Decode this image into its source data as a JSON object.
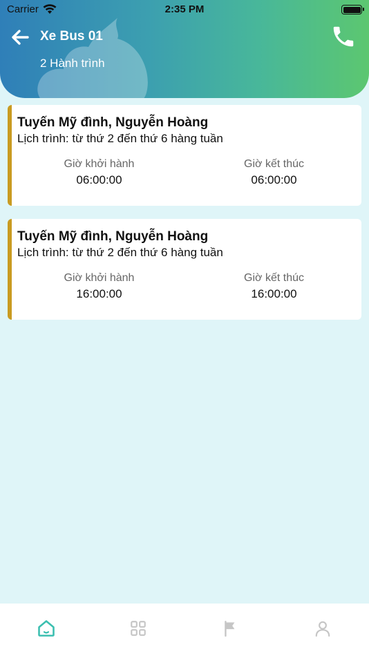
{
  "status_bar": {
    "carrier": "Carrier",
    "time": "2:35 PM"
  },
  "header": {
    "title": "Xe Bus 01",
    "subtitle": "2 Hành trình",
    "back_icon": "arrow-left-icon",
    "phone_icon": "phone-icon"
  },
  "trips": [
    {
      "route": "Tuyến Mỹ đình, Nguyễn Hoàng",
      "schedule": "Lịch trình: từ thứ 2 đến thứ 6 hàng tuần",
      "start_label": "Giờ khởi hành",
      "start_time": "06:00:00",
      "end_label": "Giờ kết thúc",
      "end_time": "06:00:00"
    },
    {
      "route": "Tuyến Mỹ đình, Nguyễn Hoàng",
      "schedule": "Lịch trình: từ thứ 2 đến thứ 6 hàng tuần",
      "start_label": "Giờ khởi hành",
      "start_time": "16:00:00",
      "end_label": "Giờ kết thúc",
      "end_time": "16:00:00"
    }
  ],
  "tabbar": {
    "items": [
      {
        "icon": "home-icon",
        "active": true
      },
      {
        "icon": "grid-icon",
        "active": false
      },
      {
        "icon": "flag-icon",
        "active": false
      },
      {
        "icon": "user-icon",
        "active": false
      }
    ]
  },
  "colors": {
    "accent": "#3bbfb0",
    "card_border": "#c99b21",
    "background": "#dff5f8",
    "inactive_icon": "#c6c6c6"
  }
}
